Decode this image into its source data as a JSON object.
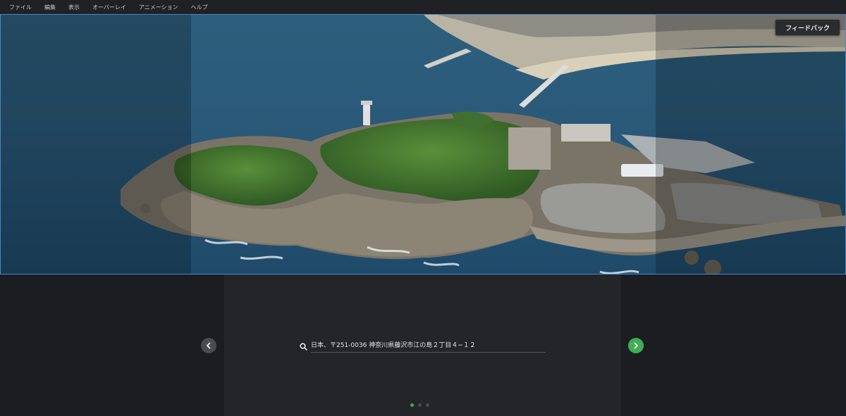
{
  "menu": {
    "items": [
      {
        "label": "ファイル"
      },
      {
        "label": "編集"
      },
      {
        "label": "表示"
      },
      {
        "label": "オーバーレイ"
      },
      {
        "label": "アニメーション"
      },
      {
        "label": "ヘルプ"
      }
    ]
  },
  "viewport": {
    "feedback_label": "フィードバック",
    "accent_color": "#4a87c9"
  },
  "slideshow": {
    "search_value": "日本、〒251-0036 神奈川県藤沢市江の島２丁目４−１２",
    "prev_icon": "chevron-left-icon",
    "next_icon": "chevron-right-icon",
    "next_color": "#3fae56",
    "pages": 3,
    "current_page": 1
  }
}
